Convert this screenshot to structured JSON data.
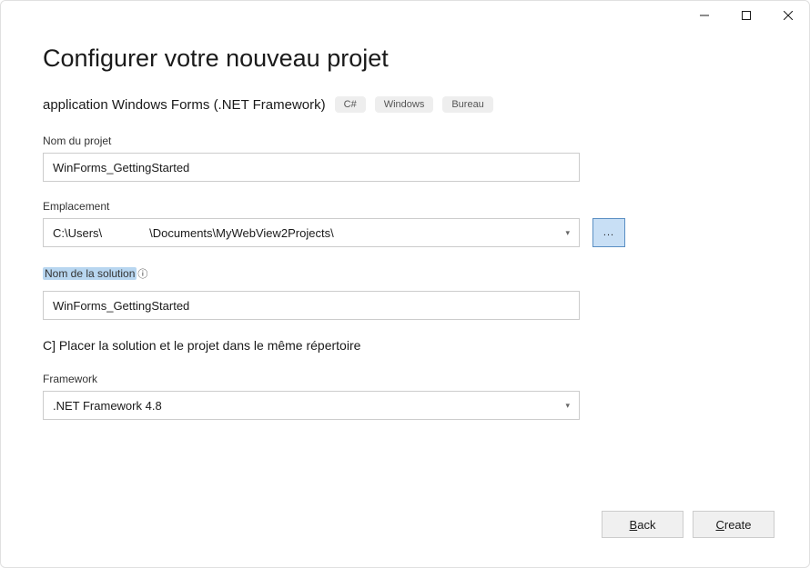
{
  "window": {
    "minimize": "—",
    "maximize": "□",
    "close": "✕"
  },
  "heading": "Configurer votre nouveau projet",
  "subheading": "application Windows Forms (.NET Framework)",
  "tags": [
    "C#",
    "Windows",
    "Bureau"
  ],
  "fields": {
    "projectName": {
      "label": "Nom du projet",
      "value": "WinForms_GettingStarted"
    },
    "location": {
      "label": "Emplacement",
      "part1": "C:\\Users\\",
      "part2": "\\Documents\\MyWebView2Projects\\",
      "browse": "..."
    },
    "solutionName": {
      "label": "Nom de la solution",
      "infoSuffix": "ⓘ",
      "value": "WinForms_GettingStarted"
    },
    "checkbox": {
      "label": "C] Placer la solution et le projet dans le même répertoire"
    },
    "framework": {
      "label": "Framework",
      "value": ".NET Framework 4.8"
    }
  },
  "footer": {
    "backAccel": "B",
    "backRest": "ack",
    "createAccel": "C",
    "createRest": "reate"
  }
}
